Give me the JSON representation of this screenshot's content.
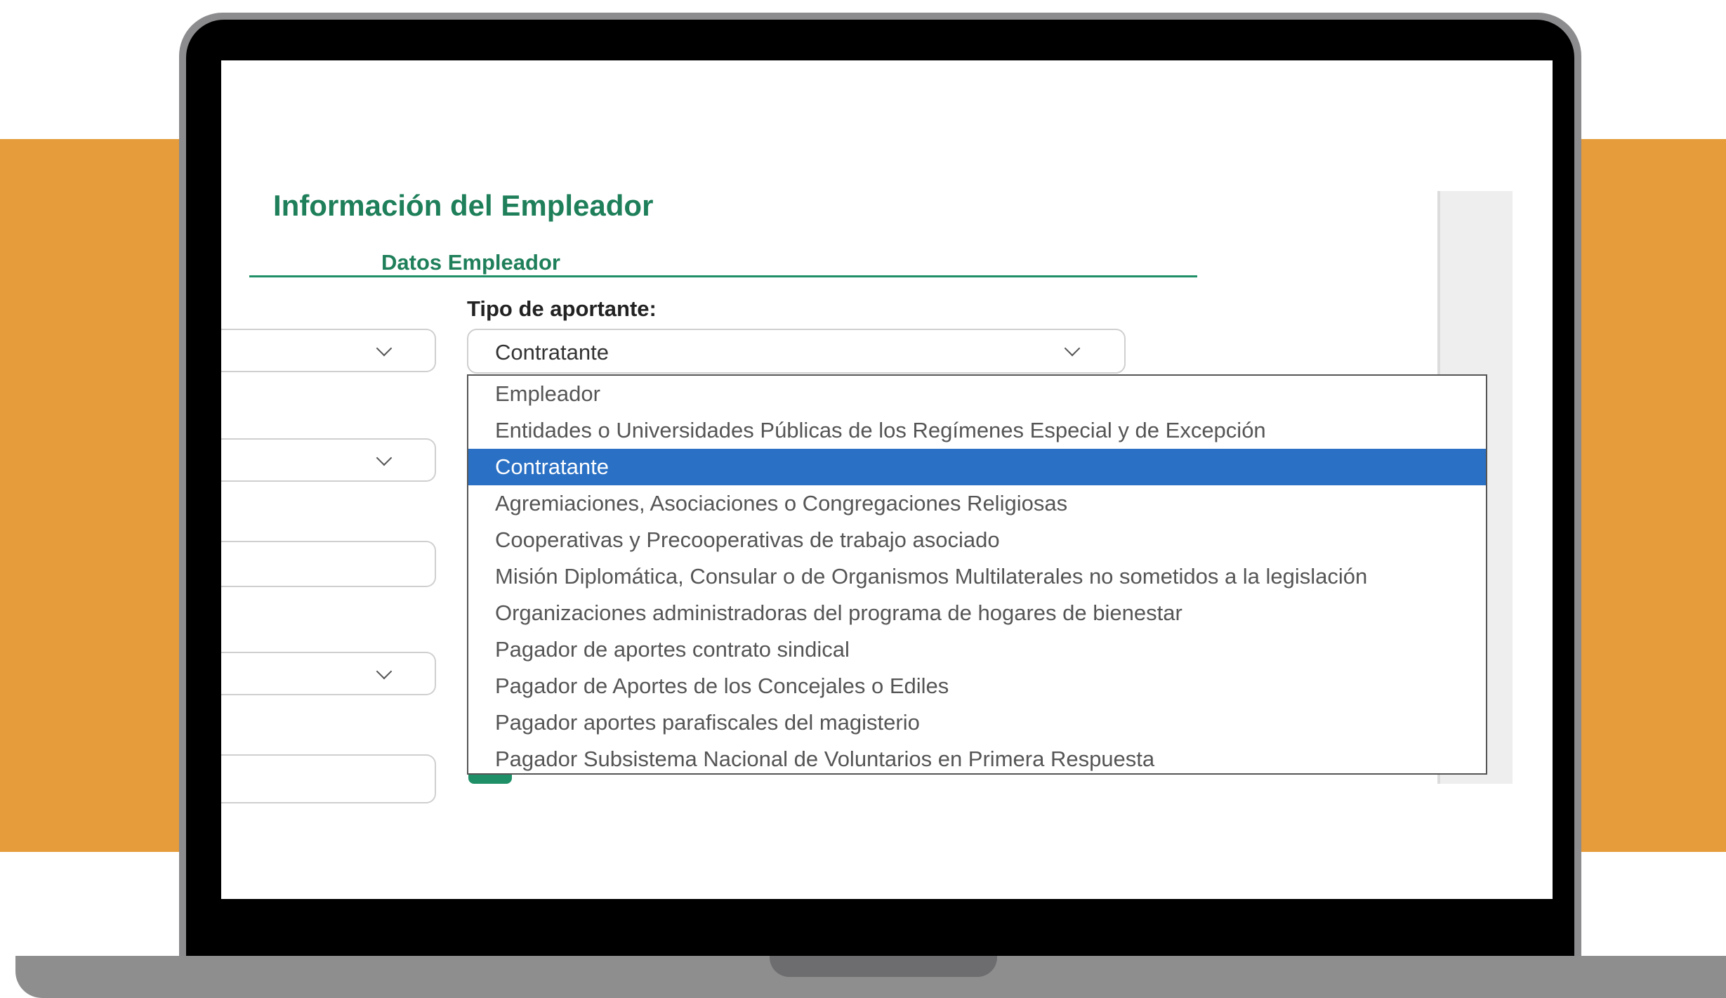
{
  "form": {
    "title": "Información del Empleador",
    "section_title": "Datos Empleador",
    "tipo_aportante": {
      "label": "Tipo de aportante:",
      "selected": "Contratante",
      "options": [
        "Empleador",
        "Entidades o Universidades Públicas de los Regímenes Especial y de Excepción",
        "Contratante",
        "Agremiaciones, Asociaciones o Congregaciones Religiosas",
        "Cooperativas y Precooperativas de trabajo asociado",
        "Misión Diplomática, Consular o de Organismos Multilaterales no sometidos a la legislación",
        "Organizaciones administradoras del programa de hogares de bienestar",
        "Pagador de aportes contrato sindical",
        "Pagador de Aportes de los Concejales o Ediles",
        "Pagador aportes parafiscales del magisterio",
        "Pagador Subsistema Nacional de Voluntarios en Primera Respuesta"
      ]
    }
  },
  "colors": {
    "background_band": "#e69c3b",
    "accent_green": "#1e7f5a",
    "selected_option": "#2a70c4"
  },
  "icons": {
    "dropdown": "chevron-down-icon",
    "search": "search-icon"
  }
}
